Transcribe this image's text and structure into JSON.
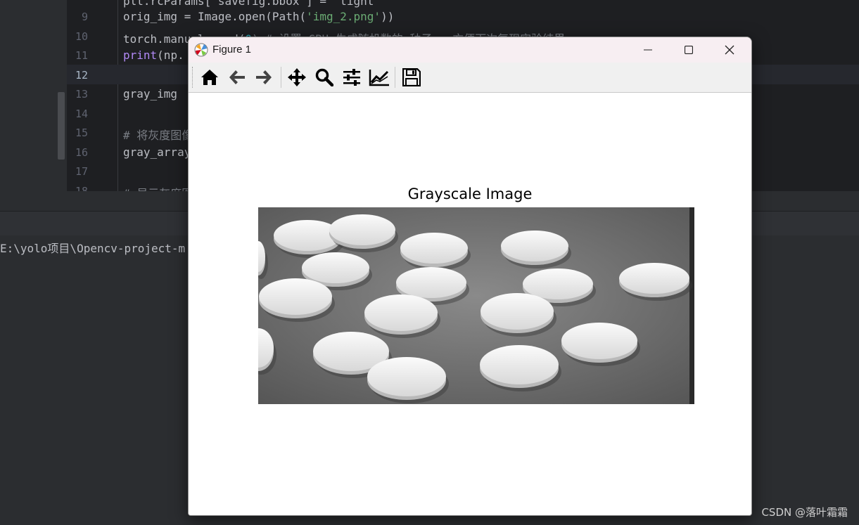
{
  "ide": {
    "lines": [
      {
        "num": "9",
        "code": [
          {
            "t": "orig_img = Image.open(Path(",
            "c": ""
          },
          {
            "t": "'img_2.png'",
            "c": "c-str"
          },
          {
            "t": "))",
            "c": ""
          }
        ]
      },
      {
        "num": "10",
        "code": [
          {
            "t": "torch.manual_seed(",
            "c": ""
          },
          {
            "t": "0",
            "c": "c-num"
          },
          {
            "t": ") # 设置 CPU 生成随机数的 种子 , 方便下次复现实验结果",
            "c": "c-cmt"
          }
        ]
      },
      {
        "num": "11",
        "code": [
          {
            "t": "print",
            "c": "c-fn"
          },
          {
            "t": "(np.",
            "c": ""
          }
        ]
      },
      {
        "num": "12",
        "code": []
      },
      {
        "num": "13",
        "code": [
          {
            "t": "gray_img ",
            "c": ""
          }
        ]
      },
      {
        "num": "14",
        "code": []
      },
      {
        "num": "15",
        "code": [
          {
            "t": "# 将灰度图像",
            "c": "c-cmt"
          }
        ]
      },
      {
        "num": "16",
        "code": [
          {
            "t": "gray_array",
            "c": ""
          }
        ]
      },
      {
        "num": "17",
        "code": []
      },
      {
        "num": "18",
        "code": [
          {
            "t": "# 显示灰度图",
            "c": "c-cmt"
          }
        ]
      }
    ],
    "first_line_fragment": "plt.rcParams['savefig.bbox'] = 'tight'",
    "active_line": "12",
    "terminal_text": "E:\\yolo项目\\Opencv-project-m"
  },
  "watermark": "CSDN @落叶霜霜",
  "figure": {
    "window_title": "Figure 1",
    "toolbar": {
      "home": "home-icon",
      "back": "arrow-left-icon",
      "forward": "arrow-right-icon",
      "pan": "move-icon",
      "zoom": "zoom-icon",
      "subplots": "sliders-icon",
      "customize": "line-chart-icon",
      "save": "save-icon"
    },
    "plot_title": "Grayscale Image"
  },
  "colors": {
    "titlebar_bg": "#f7eef2",
    "toolbar_bg": "#f0f0f0",
    "ide_bg": "#1e1f22"
  }
}
